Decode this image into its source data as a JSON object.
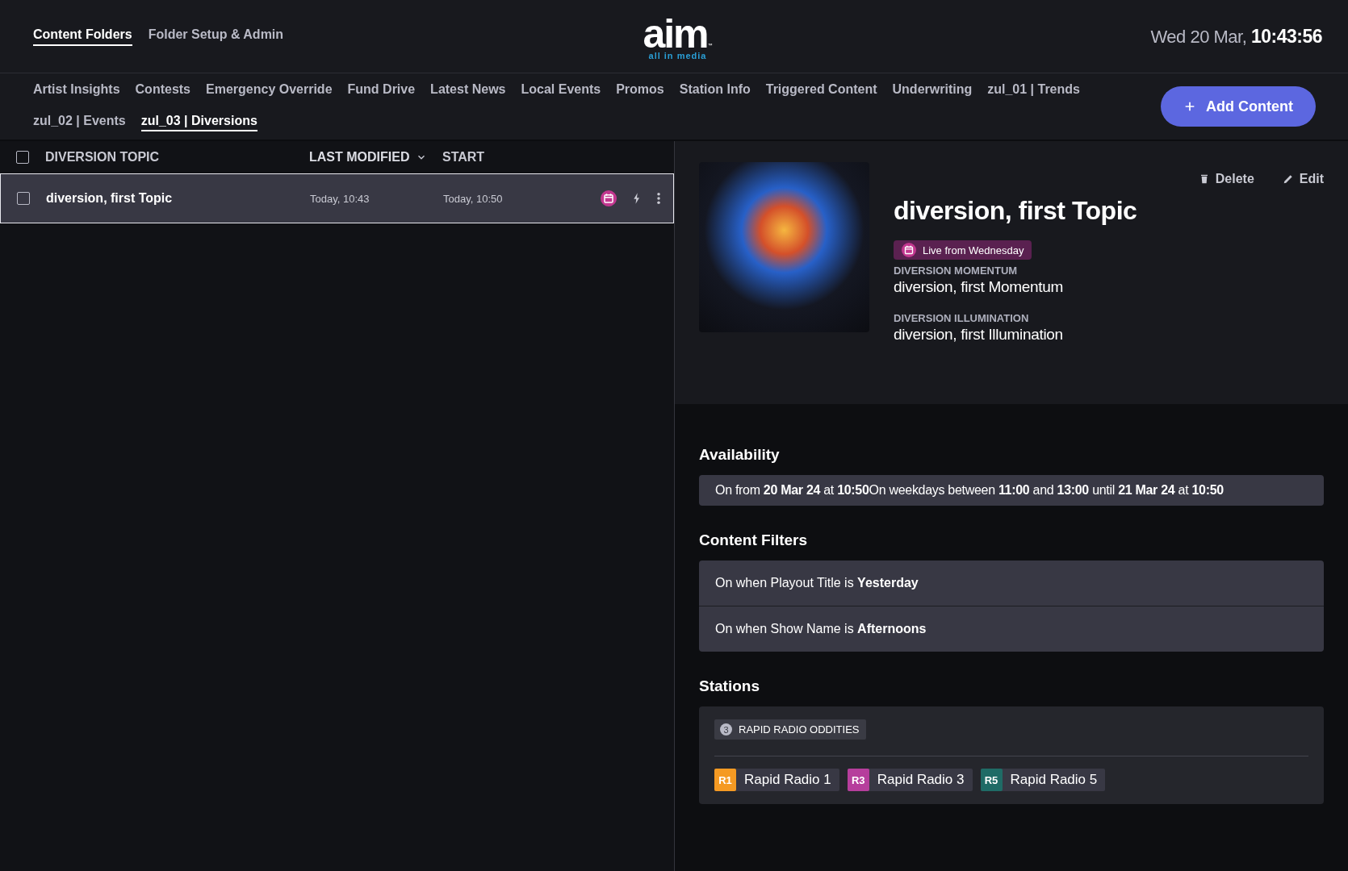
{
  "top_nav": {
    "tabs": [
      {
        "label": "Content Folders",
        "selected": true
      },
      {
        "label": "Folder Setup & Admin",
        "selected": false
      }
    ]
  },
  "logo": {
    "wordmark": "aim",
    "trademark": "™",
    "tagline": "all in media"
  },
  "clock": {
    "date": "Wed 20 Mar,",
    "time": "10:43:56"
  },
  "folder_tabs": [
    {
      "label": "Artist Insights",
      "selected": false
    },
    {
      "label": "Contests",
      "selected": false
    },
    {
      "label": "Emergency Override",
      "selected": false
    },
    {
      "label": "Fund Drive",
      "selected": false
    },
    {
      "label": "Latest News",
      "selected": false
    },
    {
      "label": "Local Events",
      "selected": false
    },
    {
      "label": "Promos",
      "selected": false
    },
    {
      "label": "Station Info",
      "selected": false
    },
    {
      "label": "Triggered Content",
      "selected": false
    },
    {
      "label": "Underwriting",
      "selected": false
    },
    {
      "label": "zul_01 | Trends",
      "selected": false
    },
    {
      "label": "zul_02 | Events",
      "selected": false
    },
    {
      "label": "zul_03 | Diversions",
      "selected": true
    }
  ],
  "add_button": {
    "label": "Add Content"
  },
  "table": {
    "select_all": {
      "checked": false
    },
    "columns": [
      {
        "label": "DIVERSION TOPIC",
        "sorted": false
      },
      {
        "label": "LAST MODIFIED",
        "sorted": true
      },
      {
        "label": "START",
        "sorted": false
      }
    ],
    "rows": [
      {
        "title": "diversion, first Topic",
        "last_modified": "Today, 10:43",
        "start": "Today, 10:50",
        "checked": false,
        "selected": true
      }
    ]
  },
  "detail": {
    "title": "diversion, first Topic",
    "actions": [
      {
        "kind": "delete",
        "label": "Delete"
      },
      {
        "kind": "edit",
        "label": "Edit"
      }
    ],
    "status_badge": "Live from Wednesday",
    "fields": [
      {
        "label": "DIVERSION MOMENTUM",
        "value": "diversion, first Momentum"
      },
      {
        "label": "DIVERSION ILLUMINATION",
        "value": "diversion, first Illumination"
      }
    ]
  },
  "availability": {
    "heading": "Availability",
    "text": "On from **20 Mar 24** at **10:50**On weekdays between **11:00** and **13:00** until **21 Mar 24** at **10:50**"
  },
  "content_filters": {
    "heading": "Content Filters",
    "items": [
      "On when Playout Title is **Yesterday**",
      "On when Show Name is **Afternoons**"
    ]
  },
  "stations": {
    "heading": "Stations",
    "group": {
      "count": "3",
      "name": "RAPID RADIO ODDITIES"
    },
    "items": [
      {
        "code": "R1",
        "name": "Rapid Radio 1",
        "color": "#f59a23"
      },
      {
        "code": "R3",
        "name": "Rapid Radio 3",
        "color": "#b63e9c"
      },
      {
        "code": "R5",
        "name": "Rapid Radio 5",
        "color": "#1f6b66"
      }
    ]
  }
}
